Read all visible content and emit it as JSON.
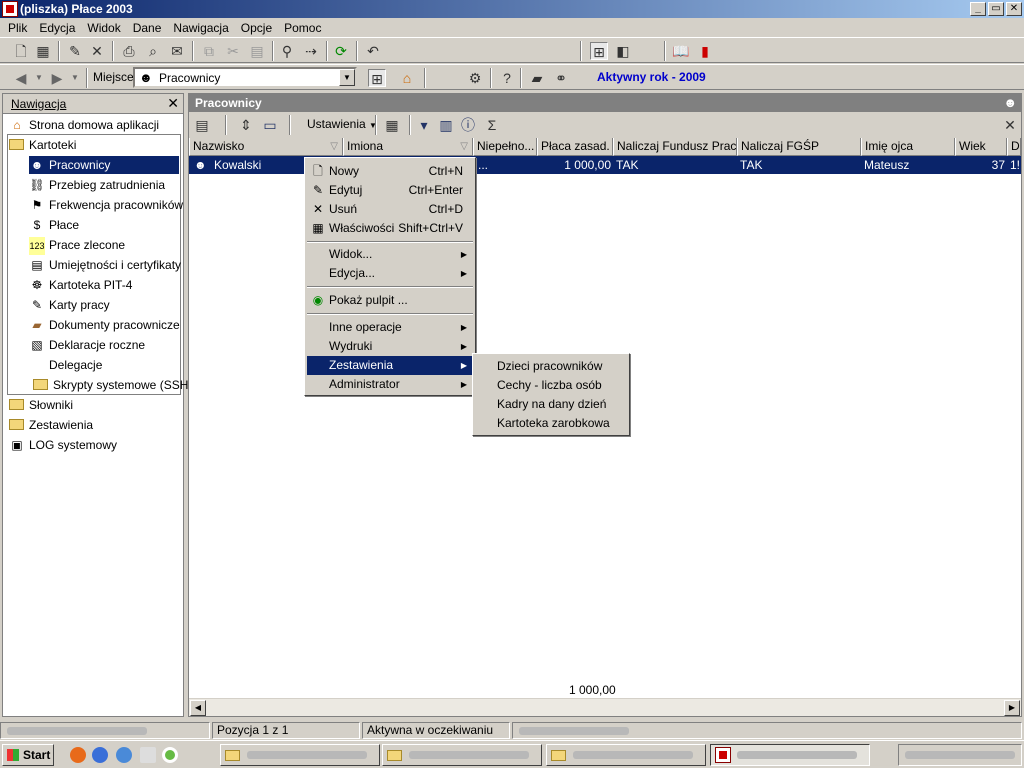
{
  "window": {
    "title": "(pliszka)  Płace 2003",
    "buttons": [
      "_",
      "▭",
      "✕"
    ]
  },
  "menubar": [
    "Plik",
    "Edycja",
    "Widok",
    "Dane",
    "Nawigacja",
    "Opcje",
    "Pomoc"
  ],
  "toolbar2": {
    "location_label": "Miejsce",
    "location_value": "Pracownicy",
    "active_year": "Aktywny rok - 2009"
  },
  "navigation": {
    "title": "Nawigacja",
    "items": [
      {
        "label": "Strona domowa aplikacji",
        "icon": "home-icon"
      },
      {
        "label": "Kartoteki",
        "icon": "folder-icon"
      },
      {
        "label": "Pracownicy",
        "icon": "employees-icon",
        "selected": true
      },
      {
        "label": "Przebieg zatrudnienia",
        "icon": "employment-history-icon"
      },
      {
        "label": "Frekwencja pracowników",
        "icon": "attendance-icon"
      },
      {
        "label": "Płace",
        "icon": "payroll-icon"
      },
      {
        "label": "Prace zlecone",
        "icon": "contract-work-icon"
      },
      {
        "label": "Umiejętności i certyfikaty",
        "icon": "certificate-icon"
      },
      {
        "label": "Kartoteka PIT-4",
        "icon": "pit4-icon"
      },
      {
        "label": "Karty pracy",
        "icon": "work-card-icon"
      },
      {
        "label": "Dokumenty pracownicze",
        "icon": "documents-icon"
      },
      {
        "label": "Deklaracje roczne",
        "icon": "declaration-icon"
      },
      {
        "label": "Delegacje",
        "icon": ""
      },
      {
        "label": "Skrypty systemowe (SSH)",
        "icon": "folder-icon"
      },
      {
        "label": "Słowniki",
        "icon": "folder-icon"
      },
      {
        "label": "Zestawienia",
        "icon": "folder-icon"
      },
      {
        "label": "LOG systemowy",
        "icon": "log-icon"
      }
    ]
  },
  "main": {
    "title": "Pracownicy",
    "settings_label": "Ustawienia",
    "sigma": "Σ",
    "columns": [
      "Nazwisko",
      "Imiona",
      "Niepełno...",
      "Płaca zasad.",
      "Naliczaj Fundusz Pracy",
      "Naliczaj FGŚP",
      "Imię ojca",
      "Wiek",
      "D"
    ],
    "row": {
      "nazwisko": "Kowalski",
      "niepelno": "...",
      "placa": "1 000,00",
      "fundusz": "TAK",
      "fgsp": "TAK",
      "imie_ojca": "Mateusz",
      "wiek": "37",
      "d": "1!"
    },
    "sum": "1 000,00"
  },
  "context_menu": {
    "items": [
      {
        "label": "Nowy",
        "shortcut": "Ctrl+N",
        "icon": "new-icon"
      },
      {
        "label": "Edytuj",
        "shortcut": "Ctrl+Enter",
        "icon": "edit-icon"
      },
      {
        "label": "Usuń",
        "shortcut": "Ctrl+D",
        "icon": "delete-icon"
      },
      {
        "label": "Właściwości",
        "shortcut": "Shift+Ctrl+V",
        "icon": "properties-icon"
      },
      {
        "label": "Widok..."
      },
      {
        "label": "Edycja..."
      },
      {
        "label": "Pokaż pulpit ...",
        "icon": "desktop-icon"
      },
      {
        "label": "Inne operacje"
      },
      {
        "label": "Wydruki"
      },
      {
        "label": "Zestawienia",
        "highlighted": true
      },
      {
        "label": "Administrator"
      }
    ]
  },
  "submenu": {
    "items": [
      "Dzieci pracowników",
      "Cechy - liczba osób",
      "Kadry na dany dzień",
      "Kartoteka zarobkowa"
    ]
  },
  "statusbar": {
    "position": "Pozycja 1 z 1",
    "state": "Aktywna w oczekiwaniu"
  },
  "taskbar": {
    "start_label": "Start"
  },
  "colors": {
    "selection": "#0a246a",
    "title_gradient_start": "#0a246a",
    "active_year": "#0000cc"
  }
}
